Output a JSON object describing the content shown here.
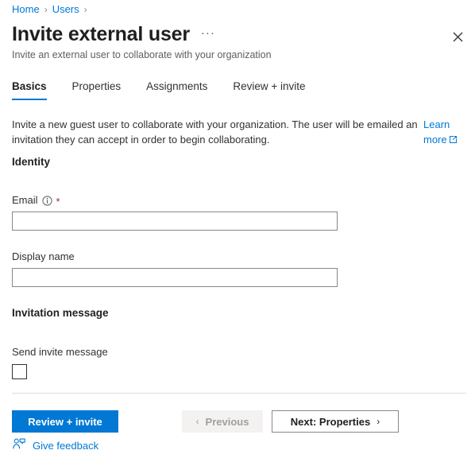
{
  "breadcrumb": {
    "items": [
      {
        "label": "Home"
      },
      {
        "label": "Users"
      }
    ],
    "separator": "›"
  },
  "header": {
    "title": "Invite external user",
    "subtitle": "Invite an external user to collaborate with your organization",
    "more_menu": "···",
    "close_icon": "close-icon"
  },
  "tabs": [
    {
      "label": "Basics",
      "active": true
    },
    {
      "label": "Properties",
      "active": false
    },
    {
      "label": "Assignments",
      "active": false
    },
    {
      "label": "Review + invite",
      "active": false
    }
  ],
  "main": {
    "intro": "Invite a new guest user to collaborate with your organization. The user will be emailed an invitation they can accept in order to begin collaborating.",
    "learn_more": "Learn more",
    "identity_heading": "Identity",
    "email_label": "Email",
    "email_required": "*",
    "email_value": "",
    "email_placeholder": "",
    "display_name_label": "Display name",
    "display_name_value": "",
    "display_name_placeholder": "",
    "invitation_heading": "Invitation message",
    "send_invite_label": "Send invite message",
    "send_invite_checked": false
  },
  "footer": {
    "review_invite": "Review + invite",
    "previous": "Previous",
    "previous_chevron": "‹",
    "next": "Next: Properties",
    "next_chevron": "›",
    "give_feedback": "Give feedback"
  },
  "colors": {
    "accent": "#0078d4",
    "required": "#a4262c",
    "text": "#323130",
    "muted": "#605e5c",
    "border": "#8a8886",
    "divider": "#e1dfdd",
    "disabled_bg": "#f3f2f1",
    "disabled_text": "#a19f9d"
  }
}
